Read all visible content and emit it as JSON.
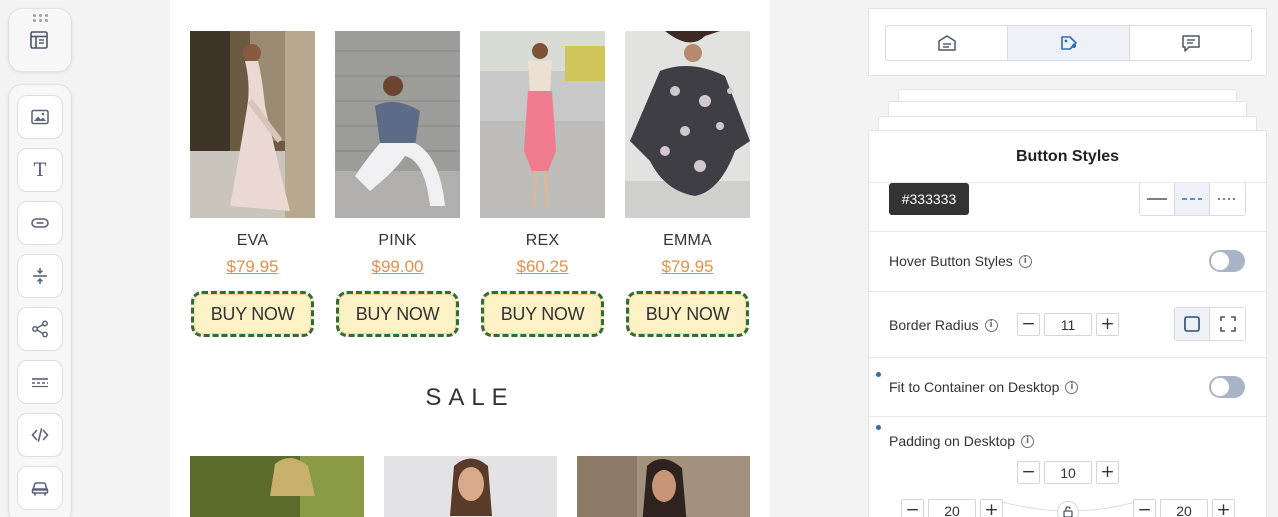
{
  "toolbar": {
    "top": {
      "icon": "layout-icon"
    },
    "items": [
      {
        "name": "image-block",
        "icon": "image-icon"
      },
      {
        "name": "text-block",
        "icon": "text-icon",
        "glyph": "T"
      },
      {
        "name": "button-block",
        "icon": "button-icon"
      },
      {
        "name": "spacer-block",
        "icon": "spacer-icon"
      },
      {
        "name": "social-block",
        "icon": "share-icon"
      },
      {
        "name": "divider-block",
        "icon": "divider-icon"
      },
      {
        "name": "html-block",
        "icon": "code-icon"
      },
      {
        "name": "product-block",
        "icon": "car-icon"
      }
    ]
  },
  "canvas": {
    "products": [
      {
        "name": "EVA",
        "price": "$79.95",
        "button": "BUY NOW"
      },
      {
        "name": "PINK",
        "price": "$99.00",
        "button": "BUY NOW"
      },
      {
        "name": "REX",
        "price": "$60.25",
        "button": "BUY NOW"
      },
      {
        "name": "EMMA",
        "price": "$79.95",
        "button": "BUY NOW"
      }
    ],
    "sale_heading": "SALE"
  },
  "panel": {
    "tabs": [
      {
        "icon": "content-icon",
        "active": false
      },
      {
        "icon": "style-icon",
        "active": true
      },
      {
        "icon": "comment-icon",
        "active": false
      }
    ],
    "title": "Button Styles",
    "border_color": "#333333",
    "border_styles": [
      "solid",
      "dashed",
      "dotted"
    ],
    "border_style_selected": "dashed",
    "hover_label": "Hover Button Styles",
    "hover_enabled": false,
    "radius_label": "Border Radius",
    "radius_value": "11",
    "fit_label": "Fit to Container on Desktop",
    "fit_enabled": false,
    "padding_label": "Padding on Desktop",
    "padding_top": "10",
    "padding_left": "20",
    "padding_right": "20"
  },
  "colors": {
    "price": "#e0914d",
    "button_bg": "#fdf1c6",
    "button_border": "#2f6b3b",
    "accent": "#2d6cb5"
  }
}
